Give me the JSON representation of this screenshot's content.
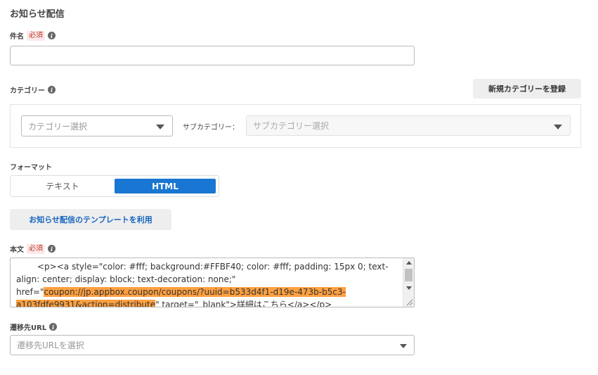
{
  "page": {
    "title": "お知らせ配信"
  },
  "subject": {
    "label": "件名",
    "required": "必須",
    "value": "",
    "placeholder": ""
  },
  "category": {
    "label": "カテゴリー",
    "register_button": "新規カテゴリーを登録",
    "select_placeholder": "カテゴリー選択",
    "sub_label": "サブカテゴリー：",
    "sub_placeholder": "サブカテゴリー選択"
  },
  "format": {
    "label": "フォーマット",
    "options": [
      "テキスト",
      "HTML"
    ],
    "selected": "HTML"
  },
  "template_button": "お知らせ配信のテンプレートを利用",
  "body": {
    "label": "本文",
    "required": "必須",
    "text_before": "<p><a style=\"color: #fff; background:#FFBF40; color: #fff; padding: 15px 0; text-align: center; display: block; text-decoration: none;\" href=\"",
    "text_highlight": "coupon://jp.appbox.coupon/coupons/?uuid=b533d4f1-d19e-473b-b5c3-a103fdfe9931&action=distribute",
    "text_after": "\" target=\"_blank\">詳細はこちら</a></p>"
  },
  "destination": {
    "label": "遷移先URL",
    "placeholder": "遷移先URLを選択"
  },
  "colors": {
    "accent": "#1976d2",
    "highlight": "#ffa040",
    "required_text": "#c0392b"
  }
}
